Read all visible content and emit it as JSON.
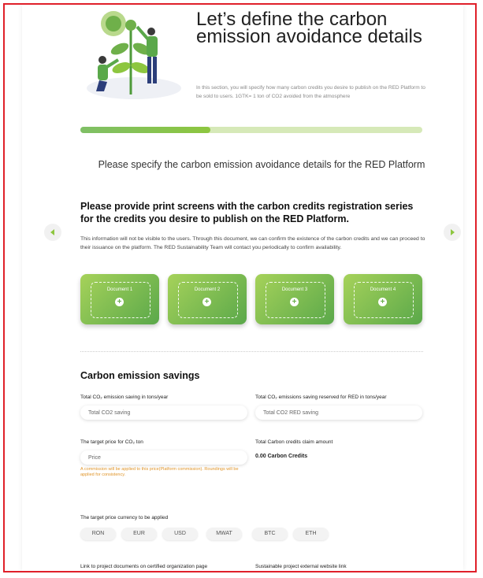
{
  "header": {
    "title": "Let’s define the carbon emission avoidance details",
    "intro": "In this section, you will specify how many carbon credits you desire to publish on the RED Platform to be sold to users. 1GTK= 1 ton of CO2 avoided from the atmosphere"
  },
  "progress": {
    "fraction": 0.38
  },
  "subtitle": "Please specify the carbon emission avoidance details for the RED Platform",
  "print_screens": {
    "title": "Please provide print screens with the carbon credits registration series for the credits you desire to publish on the RED Platform.",
    "description": "This information will not be visible to the users. Through this document, we can confirm the existence of the carbon credits and we can proceed to their issuance on the platform. The RED Sustainability Team will contact you periodically to confirm availability.",
    "documents": [
      {
        "label": "Document 1"
      },
      {
        "label": "Document 2"
      },
      {
        "label": "Document 3"
      },
      {
        "label": "Document 4"
      }
    ]
  },
  "savings": {
    "title": "Carbon emission savings",
    "total_saving_label": "Total CO₂ emission saving in tons/year",
    "total_saving_placeholder": "Total CO2 saving",
    "reserved_label": "Total CO₂ emissions saving reserved for RED in tons/year",
    "reserved_placeholder": "Total CO2 RED saving",
    "price_label": "The target price for CO₂ ton",
    "price_placeholder": "Price",
    "price_note": "A commission will be applied to this price(Platform commission). Roundings will be applied for consistency.",
    "claim_label": "Total Carbon credits claim amount",
    "claim_value": "0.00 Carbon Credits",
    "currency_label": "The target price currency to be applied",
    "currencies": [
      "RON",
      "EUR",
      "USD",
      "MWAT",
      "BTC",
      "ETH"
    ],
    "link_label": "Link to project documents on certified organization page",
    "website_label": "Sustainable project external website link"
  },
  "colors": {
    "accent": "#8dc63f",
    "frame": "#e0202a",
    "note": "#e0952a"
  },
  "icons": {
    "prev": "chevron-left-icon",
    "next": "chevron-right-icon",
    "add": "plus-icon"
  }
}
